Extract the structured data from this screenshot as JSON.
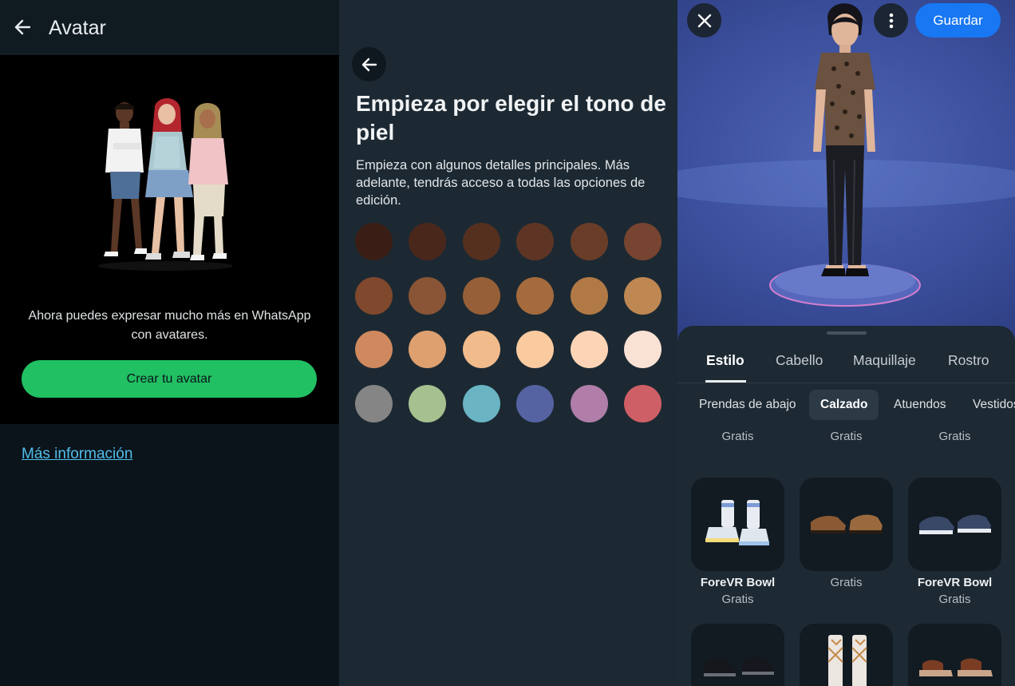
{
  "whatsapp": {
    "title": "Avatar",
    "message": "Ahora puedes expresar mucho más en WhatsApp con avatares.",
    "create_button": "Crear tu avatar",
    "more_info": "Más información"
  },
  "skin": {
    "title": "Empieza por elegir el tono de piel",
    "subtitle": "Empieza con algunos detalles principales. Más adelante, tendrás acceso a todas las opciones de edición.",
    "tones": [
      [
        "#3a1e16",
        "#4a271b",
        "#55301f",
        "#5e3524",
        "#6a3d28",
        "#764430"
      ],
      [
        "#80482c",
        "#8a5536",
        "#975f37",
        "#a56b3c",
        "#b17945",
        "#bf8752"
      ],
      [
        "#d0895e",
        "#dea06f",
        "#f2bb8c",
        "#fbcba0",
        "#fdd5b6",
        "#f9e1d4"
      ],
      [
        "#858585",
        "#a6c08f",
        "#6ab4c3",
        "#5663a3",
        "#b07ea9",
        "#cf5f66"
      ]
    ]
  },
  "editor": {
    "save": "Guardar",
    "tabs": [
      "Estilo",
      "Cabello",
      "Maquillaje",
      "Rostro"
    ],
    "chips": [
      "Prendas de abajo",
      "Calzado",
      "Atuendos",
      "Vestidos"
    ],
    "top_prices": [
      "Gratis",
      "Gratis",
      "Gratis"
    ],
    "items": [
      {
        "name": "ForeVR Bowl",
        "price": "Gratis"
      },
      {
        "name": "",
        "price": "Gratis"
      },
      {
        "name": "ForeVR Bowl",
        "price": "Gratis"
      }
    ]
  },
  "colors": {
    "whatsapp_green": "#21c063",
    "link_blue": "#53bdeb",
    "meta_blue": "#1877f2"
  }
}
